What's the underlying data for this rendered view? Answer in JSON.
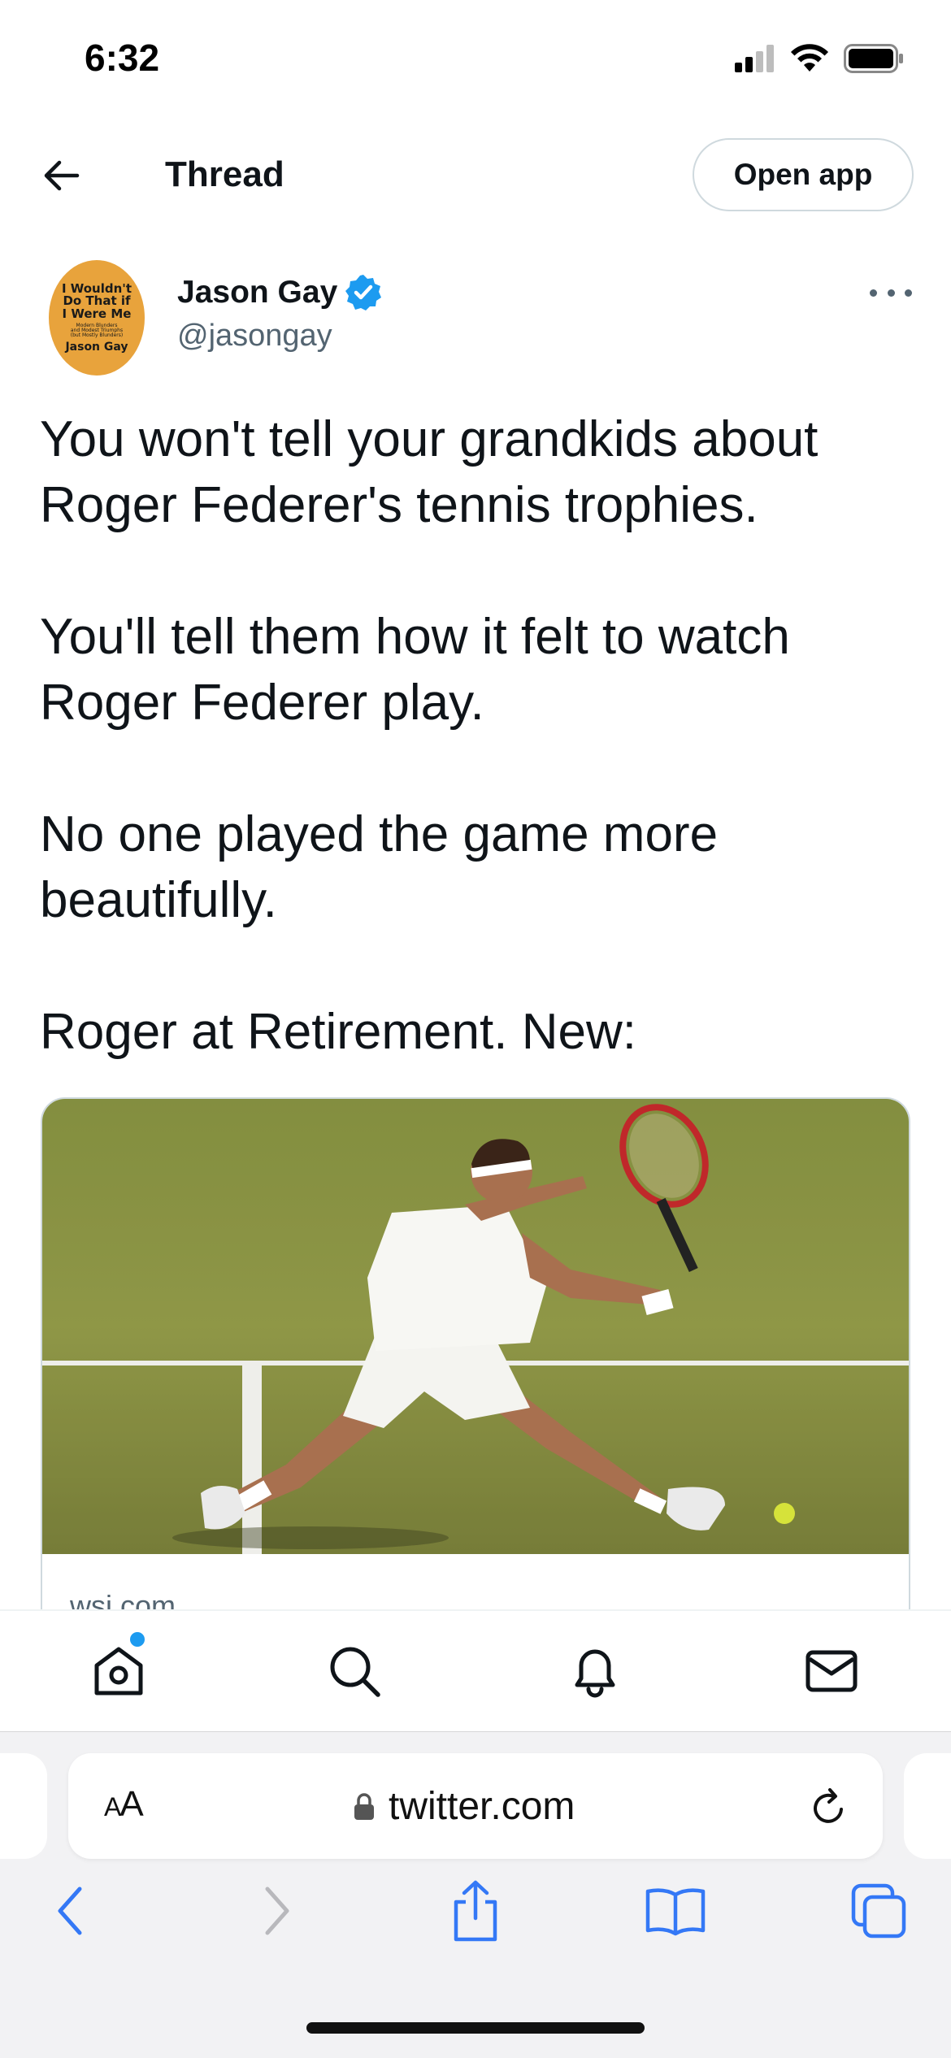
{
  "status_bar": {
    "time": "6:32",
    "icons": [
      "cellular-signal-icon",
      "wifi-icon",
      "battery-icon"
    ]
  },
  "header": {
    "back_icon": "arrow-left-icon",
    "title": "Thread",
    "open_app_label": "Open app"
  },
  "tweet": {
    "author": {
      "name": "Jason Gay",
      "handle": "@jasongay",
      "verified": true,
      "avatar_text": {
        "line1": "I Wouldn't",
        "line2": "Do That if",
        "line3": "I Were Me",
        "line4": "Modern Blunders",
        "line5": "and Modest Triumphs",
        "line6": "(but Mostly Blunders)",
        "line7": "Jason Gay"
      }
    },
    "more_icon": "more-horizontal-icon",
    "paragraphs": [
      "You won't tell your grandkids about Roger Federer's tennis trophies.",
      "You'll tell them how it felt to watch Roger Federer play.",
      "No one played the game more beautifully.",
      "Roger at Retirement. New:"
    ],
    "card": {
      "image_icon": "tennis-player-photo",
      "domain": "wsj.com"
    }
  },
  "tabbar": {
    "items": [
      {
        "name": "home-icon",
        "has_dot": true
      },
      {
        "name": "search-icon"
      },
      {
        "name": "notifications-bell-icon"
      },
      {
        "name": "messages-envelope-icon"
      }
    ]
  },
  "safari": {
    "aa_label_big": "A",
    "aa_label_small": "A",
    "url": "twitter.com",
    "lock_icon": "lock-icon",
    "reload_icon": "reload-icon",
    "nav": [
      "back-chevron-icon",
      "forward-chevron-icon",
      "share-icon",
      "bookmarks-book-icon",
      "tabs-icon"
    ]
  },
  "colors": {
    "accent": "#1d9bf0",
    "safari_blue": "#3478f6",
    "text_primary": "#0f1419",
    "text_secondary": "#536471",
    "border": "#cfd9de"
  }
}
